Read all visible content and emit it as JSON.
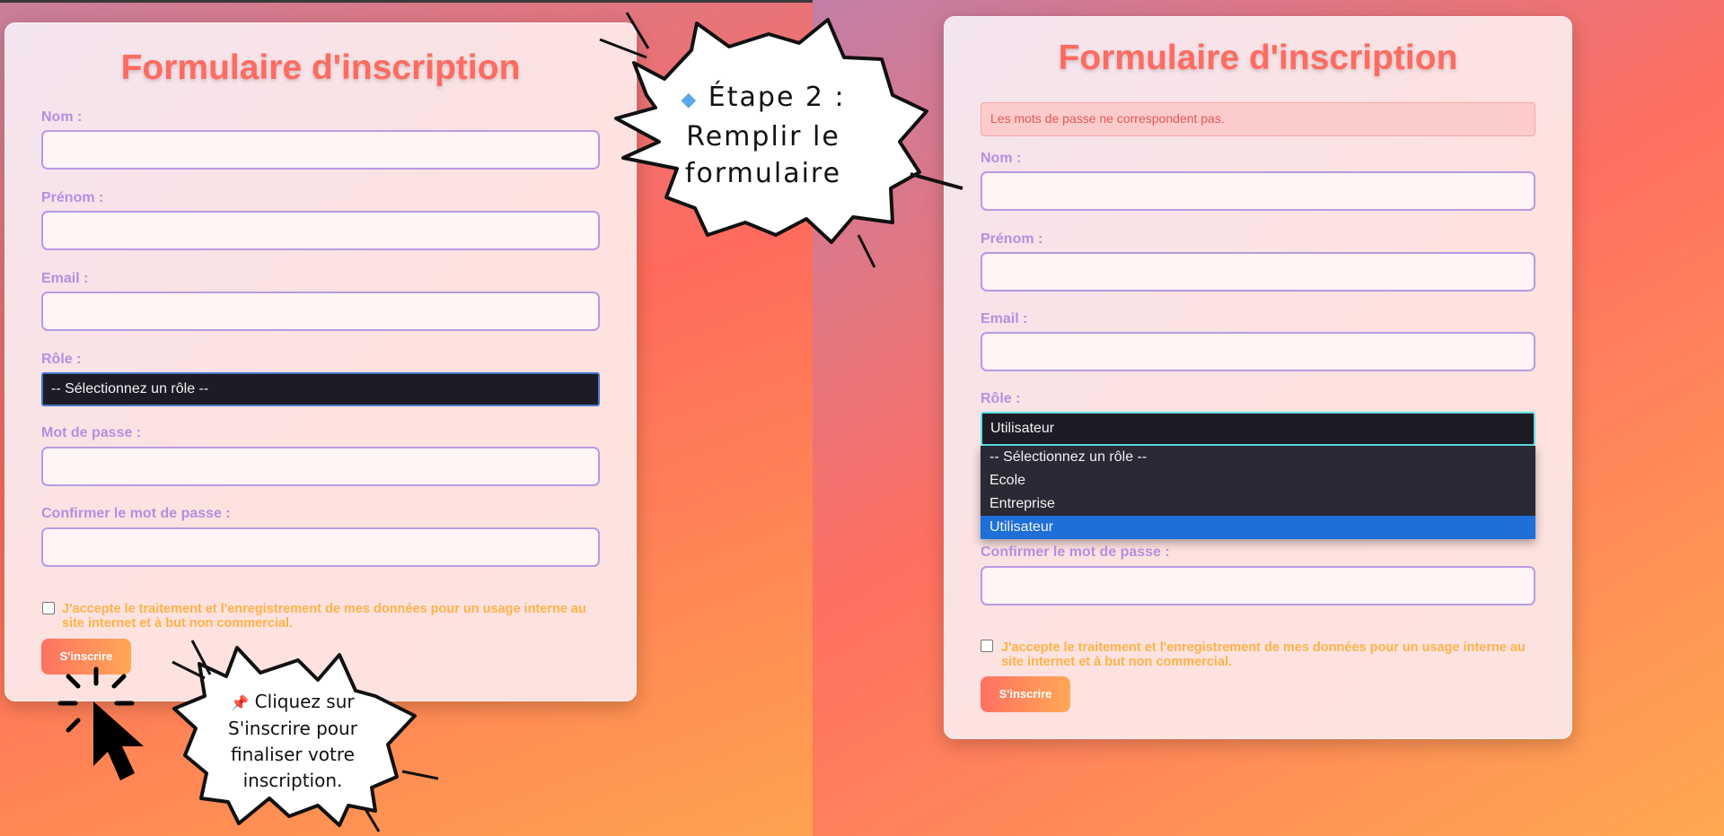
{
  "left": {
    "title": "Formulaire d'inscription",
    "labels": {
      "nom": "Nom :",
      "prenom": "Prénom :",
      "email": "Email :",
      "role": "Rôle :",
      "password": "Mot de passe :",
      "confirm": "Confirmer le mot de passe :"
    },
    "role_value": "-- Sélectionnez un rôle --",
    "consent": "J'accepte le traitement et l'enregistrement de mes données pour un usage interne au site internet et à but non commercial.",
    "submit_label": "S'inscrire"
  },
  "right": {
    "title": "Formulaire d'inscription",
    "error": "Les mots de passe ne correspondent pas.",
    "labels": {
      "nom": "Nom :",
      "prenom": "Prénom :",
      "email": "Email :",
      "role": "Rôle :",
      "confirm": "Confirmer le mot de passe :"
    },
    "role_value": "Utilisateur",
    "role_options": [
      "-- Sélectionnez un rôle --",
      "Ecole",
      "Entreprise",
      "Utilisateur"
    ],
    "consent": "J'accepte le traitement et l'enregistrement de mes données pour un usage interne au site internet et à but non commercial.",
    "submit_label": "S'inscrire"
  },
  "callouts": {
    "step2": {
      "bullet": "◆",
      "line1": "Étape 2 :",
      "line2": "Remplir le",
      "line3": "formulaire"
    },
    "submit": {
      "pin": "📌",
      "line1": "Cliquez sur",
      "line2": "S'inscrire pour",
      "line3": "finaliser votre",
      "line4": "inscription."
    }
  },
  "colors": {
    "title": "#ff6b61",
    "label": "#b58fe0",
    "consent": "#ffb24a",
    "select_bg": "#1d1c26",
    "option_highlight": "#1f6fd8"
  }
}
